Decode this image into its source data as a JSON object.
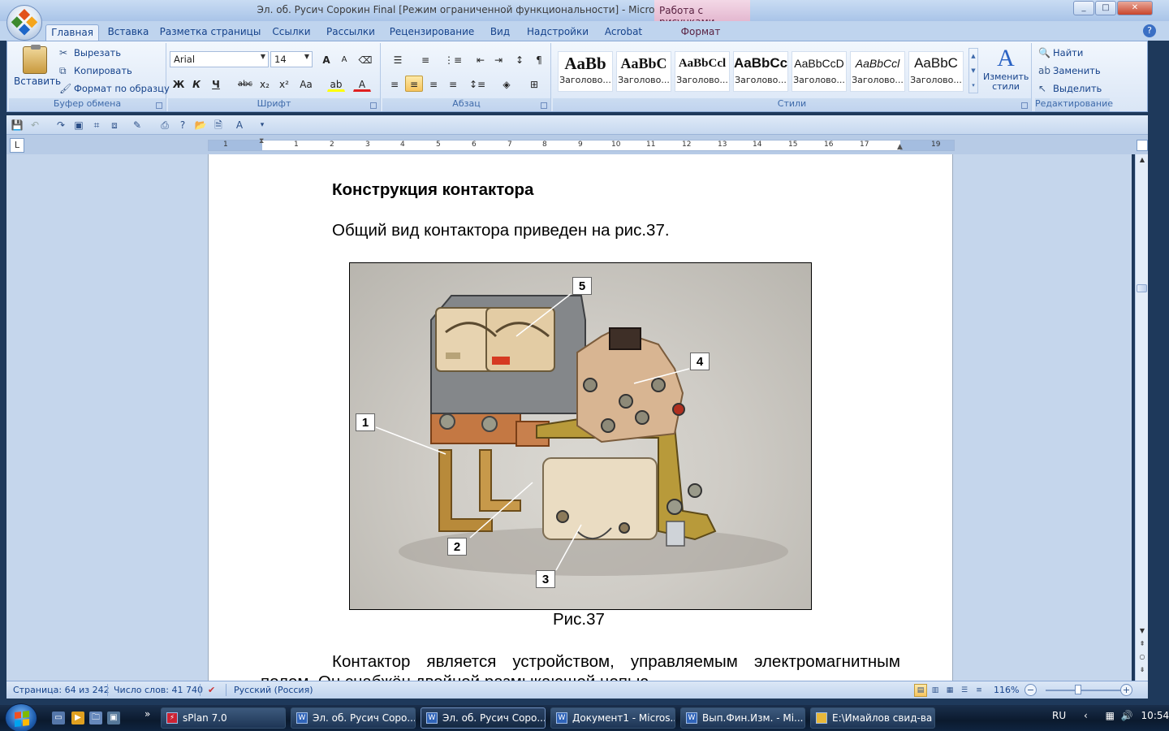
{
  "window": {
    "title": "Эл. об. Русич Сорокин Final [Режим ограниченной функциональности] - Microsoft Word",
    "context_tab": "Работа с рисунками",
    "min": "_",
    "max": "□",
    "close": "✕"
  },
  "ribbon_tabs": [
    "Главная",
    "Вставка",
    "Разметка страницы",
    "Ссылки",
    "Рассылки",
    "Рецензирование",
    "Вид",
    "Надстройки",
    "Acrobat",
    "Формат"
  ],
  "clipboard": {
    "paste": "Вставить",
    "cut": "Вырезать",
    "copy": "Копировать",
    "format_painter": "Формат по образцу",
    "label": "Буфер обмена"
  },
  "font": {
    "name": "Arial",
    "size": "14",
    "label": "Шрифт",
    "bold": "Ж",
    "italic": "К",
    "underline": "Ч",
    "strike": "abc",
    "sub": "x₂",
    "sup": "x²",
    "case": "Aa",
    "grow": "A",
    "shrink": "A"
  },
  "paragraph": {
    "label": "Абзац"
  },
  "styles": {
    "label": "Стили",
    "items": [
      {
        "sample": "AaBb",
        "name": "Заголово..."
      },
      {
        "sample": "AaBbC",
        "name": "Заголово..."
      },
      {
        "sample": "AaBbCcl",
        "name": "Заголово..."
      },
      {
        "sample": "AaBbCc",
        "name": "Заголово..."
      },
      {
        "sample": "AaBbCcD",
        "name": "Заголово..."
      },
      {
        "sample": "AaBbCcl",
        "name": "Заголово..."
      },
      {
        "sample": "AaBbC",
        "name": "Заголово..."
      }
    ],
    "change": "Изменить стили"
  },
  "editing": {
    "label": "Редактирование",
    "find": "Найти",
    "replace": "Заменить",
    "select": "Выделить"
  },
  "ruler": {
    "numbers": [
      "1",
      "1",
      "2",
      "3",
      "4",
      "5",
      "6",
      "7",
      "8",
      "9",
      "10",
      "11",
      "12",
      "13",
      "14",
      "15",
      "16",
      "17",
      "19"
    ],
    "tab_selector": "L"
  },
  "document": {
    "heading": "Конструкция контактора",
    "para1": "Общий вид контактора приведен на рис.37.",
    "caption": "Рис.37",
    "para2_line1": "Контактор является устройством, управляемым электромагнитным",
    "para2_line2": "полем. Он снабжён двойной размыкающей цепью.",
    "callouts": [
      "1",
      "2",
      "3",
      "4",
      "5"
    ]
  },
  "statusbar": {
    "page": "Страница: 64 из 242",
    "words": "Число слов: 41 740",
    "language": "Русский (Россия)",
    "zoom": "116%"
  },
  "taskbar": {
    "items": [
      {
        "label": "sPlan 7.0",
        "icon": "splan-icon"
      },
      {
        "label": "Эл. об. Русич Соро...",
        "icon": "word-icon"
      },
      {
        "label": "Эл. об. Русич Соро...",
        "icon": "word-icon"
      },
      {
        "label": "Документ1 - Micros...",
        "icon": "word-icon"
      },
      {
        "label": "Вып.Фин.Изм. - Mi...",
        "icon": "word-icon"
      },
      {
        "label": "E:\\Имайлов свид-ва",
        "icon": "folder-icon"
      }
    ],
    "language": "RU",
    "time": "10:54",
    "chevron": "»"
  }
}
